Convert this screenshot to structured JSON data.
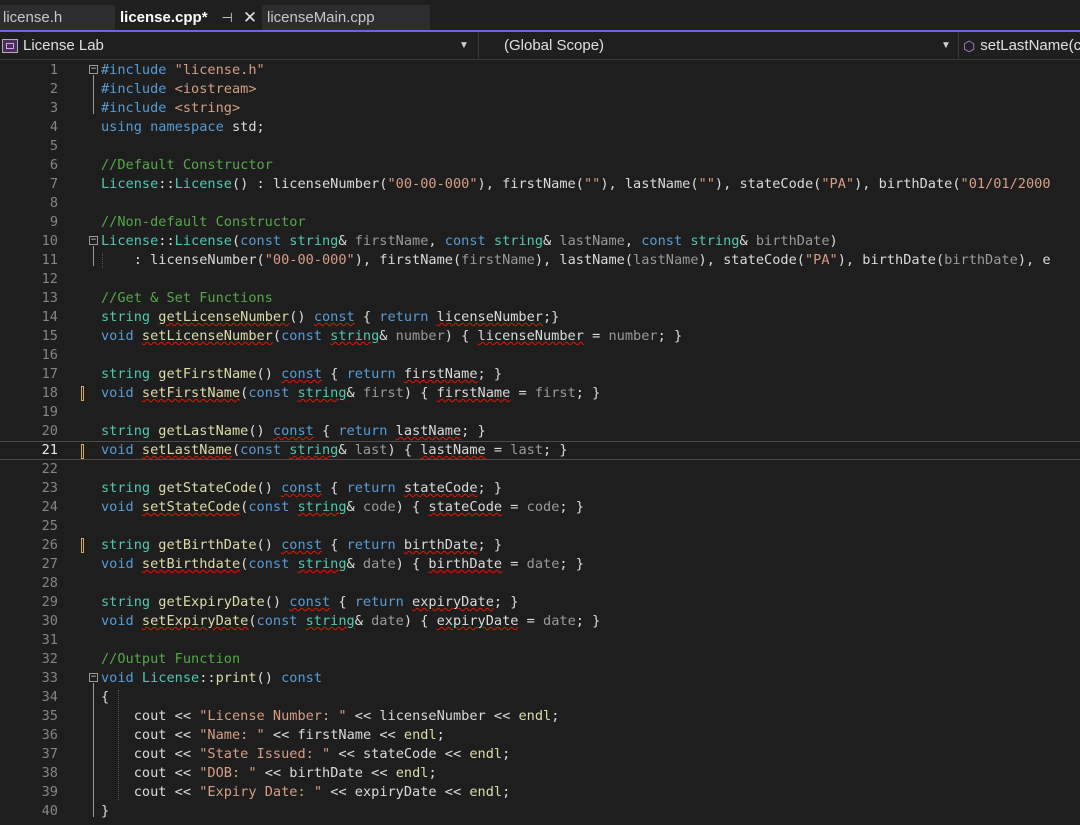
{
  "tabs": [
    {
      "label": "license.h"
    },
    {
      "label": "license.cpp*",
      "pin": "⊣",
      "close": "✕"
    },
    {
      "label": "licenseMain.cpp"
    }
  ],
  "navbar": {
    "project": "License Lab",
    "scope": "(Global Scope)",
    "member": "setLastName(c"
  },
  "editor": {
    "current_line": 21,
    "line_numbers": [
      "1",
      "2",
      "3",
      "4",
      "5",
      "6",
      "7",
      "8",
      "9",
      "10",
      "11",
      "12",
      "13",
      "14",
      "15",
      "16",
      "17",
      "18",
      "19",
      "20",
      "21",
      "22",
      "23",
      "24",
      "25",
      "26",
      "27",
      "28",
      "29",
      "30",
      "31",
      "32",
      "33",
      "34",
      "35",
      "36",
      "37",
      "38",
      "39",
      "40"
    ],
    "lines": [
      [
        [
          "kw",
          "#include "
        ],
        [
          "str",
          "\"license.h\""
        ]
      ],
      [
        [
          "kw",
          "#include "
        ],
        [
          "str",
          "<iostream>"
        ]
      ],
      [
        [
          "kw",
          "#include "
        ],
        [
          "str",
          "<string>"
        ]
      ],
      [
        [
          "kw",
          "using namespace "
        ],
        [
          "",
          "std;"
        ]
      ],
      [],
      [
        [
          "com",
          "//Default Constructor"
        ]
      ],
      [
        [
          "cls",
          "License"
        ],
        [
          "",
          "::"
        ],
        [
          "cls",
          "License"
        ],
        [
          "",
          "() : "
        ],
        [
          "var",
          "licenseNumber"
        ],
        [
          "",
          "("
        ],
        [
          "str",
          "\"00-00-000\""
        ],
        [
          "",
          "), "
        ],
        [
          "var",
          "firstName"
        ],
        [
          "",
          "("
        ],
        [
          "str",
          "\"\""
        ],
        [
          "",
          "), "
        ],
        [
          "var",
          "lastName"
        ],
        [
          "",
          "("
        ],
        [
          "str",
          "\"\""
        ],
        [
          "",
          "), "
        ],
        [
          "var",
          "stateCode"
        ],
        [
          "",
          "("
        ],
        [
          "str",
          "\"PA\""
        ],
        [
          "",
          "), "
        ],
        [
          "var",
          "birthDate"
        ],
        [
          "",
          "("
        ],
        [
          "str",
          "\"01/01/2000"
        ]
      ],
      [],
      [
        [
          "com",
          "//Non-default Constructor"
        ]
      ],
      [
        [
          "cls",
          "License"
        ],
        [
          "",
          "::"
        ],
        [
          "cls",
          "License"
        ],
        [
          "",
          "("
        ],
        [
          "kw",
          "const "
        ],
        [
          "cls",
          "string"
        ],
        [
          "",
          "& "
        ],
        [
          "par",
          "firstName"
        ],
        [
          "",
          ", "
        ],
        [
          "kw",
          "const "
        ],
        [
          "cls",
          "string"
        ],
        [
          "",
          "& "
        ],
        [
          "par",
          "lastName"
        ],
        [
          "",
          ", "
        ],
        [
          "kw",
          "const "
        ],
        [
          "cls",
          "string"
        ],
        [
          "",
          "& "
        ],
        [
          "par",
          "birthDate"
        ],
        [
          "",
          ")"
        ]
      ],
      [
        [
          "",
          "    : "
        ],
        [
          "var",
          "licenseNumber"
        ],
        [
          "",
          "("
        ],
        [
          "str",
          "\"00-00-000\""
        ],
        [
          "",
          "), "
        ],
        [
          "var",
          "firstName"
        ],
        [
          "",
          "("
        ],
        [
          "par",
          "firstName"
        ],
        [
          "",
          "), "
        ],
        [
          "var",
          "lastName"
        ],
        [
          "",
          "("
        ],
        [
          "par",
          "lastName"
        ],
        [
          "",
          "), "
        ],
        [
          "var",
          "stateCode"
        ],
        [
          "",
          "("
        ],
        [
          "str",
          "\"PA\""
        ],
        [
          "",
          "), "
        ],
        [
          "var",
          "birthDate"
        ],
        [
          "",
          "("
        ],
        [
          "par",
          "birthDate"
        ],
        [
          "",
          "), e"
        ]
      ],
      [],
      [
        [
          "com",
          "//Get & Set Functions"
        ]
      ],
      [
        [
          "cls",
          "string "
        ],
        [
          "fn sq",
          "getLicenseNumber"
        ],
        [
          "",
          "() "
        ],
        [
          "kw sq",
          "const"
        ],
        [
          "",
          " { "
        ],
        [
          "kw",
          "return "
        ],
        [
          "var sq",
          "licenseNumber"
        ],
        [
          "",
          ";}"
        ]
      ],
      [
        [
          "kw",
          "void "
        ],
        [
          "fn sq",
          "setLicenseNumber"
        ],
        [
          "",
          "("
        ],
        [
          "kw",
          "const "
        ],
        [
          "cls sq",
          "string"
        ],
        [
          "",
          "& "
        ],
        [
          "par",
          "number"
        ],
        [
          "",
          ") { "
        ],
        [
          "var sq",
          "licenseNumber"
        ],
        [
          "",
          " = "
        ],
        [
          "par",
          "number"
        ],
        [
          "",
          "; }"
        ]
      ],
      [],
      [
        [
          "cls",
          "string "
        ],
        [
          "fn",
          "getFirstName"
        ],
        [
          "",
          "() "
        ],
        [
          "kw sq",
          "const"
        ],
        [
          "",
          " { "
        ],
        [
          "kw",
          "return "
        ],
        [
          "var sq",
          "firstName"
        ],
        [
          "",
          "; }"
        ]
      ],
      [
        [
          "kw",
          "void "
        ],
        [
          "fn sq",
          "setFirstName"
        ],
        [
          "",
          "("
        ],
        [
          "kw",
          "const "
        ],
        [
          "cls sq",
          "string"
        ],
        [
          "",
          "& "
        ],
        [
          "par",
          "first"
        ],
        [
          "",
          ") { "
        ],
        [
          "var sq",
          "firstName"
        ],
        [
          "",
          " = "
        ],
        [
          "par",
          "first"
        ],
        [
          "",
          "; }"
        ]
      ],
      [],
      [
        [
          "cls",
          "string "
        ],
        [
          "fn",
          "getLastName"
        ],
        [
          "",
          "() "
        ],
        [
          "kw sq",
          "const"
        ],
        [
          "",
          " { "
        ],
        [
          "kw",
          "return "
        ],
        [
          "var sq",
          "lastName"
        ],
        [
          "",
          "; }"
        ]
      ],
      [
        [
          "kw",
          "void "
        ],
        [
          "fn sq",
          "setLastName"
        ],
        [
          "",
          "("
        ],
        [
          "kw",
          "const "
        ],
        [
          "cls sq",
          "string"
        ],
        [
          "",
          "& "
        ],
        [
          "par",
          "last"
        ],
        [
          "",
          ") { "
        ],
        [
          "var sq",
          "lastName"
        ],
        [
          "",
          " = "
        ],
        [
          "par",
          "last"
        ],
        [
          "",
          "; }"
        ]
      ],
      [],
      [
        [
          "cls",
          "string "
        ],
        [
          "fn",
          "getStateCode"
        ],
        [
          "",
          "() "
        ],
        [
          "kw sq",
          "const"
        ],
        [
          "",
          " { "
        ],
        [
          "kw",
          "return "
        ],
        [
          "var sq",
          "stateCode"
        ],
        [
          "",
          "; }"
        ]
      ],
      [
        [
          "kw",
          "void "
        ],
        [
          "fn sq",
          "setStateCode"
        ],
        [
          "",
          "("
        ],
        [
          "kw",
          "const "
        ],
        [
          "cls sq",
          "string"
        ],
        [
          "",
          "& "
        ],
        [
          "par",
          "code"
        ],
        [
          "",
          ") { "
        ],
        [
          "var sq",
          "stateCode"
        ],
        [
          "",
          " = "
        ],
        [
          "par",
          "code"
        ],
        [
          "",
          "; }"
        ]
      ],
      [],
      [
        [
          "cls",
          "string "
        ],
        [
          "fn",
          "getBirthDate"
        ],
        [
          "",
          "() "
        ],
        [
          "kw sq",
          "const"
        ],
        [
          "",
          " { "
        ],
        [
          "kw",
          "return "
        ],
        [
          "var sq",
          "birthDate"
        ],
        [
          "",
          "; }"
        ]
      ],
      [
        [
          "kw",
          "void "
        ],
        [
          "fn sq",
          "setBirthdate"
        ],
        [
          "",
          "("
        ],
        [
          "kw",
          "const "
        ],
        [
          "cls sq",
          "string"
        ],
        [
          "",
          "& "
        ],
        [
          "par",
          "date"
        ],
        [
          "",
          ") { "
        ],
        [
          "var sq",
          "birthDate"
        ],
        [
          "",
          " = "
        ],
        [
          "par",
          "date"
        ],
        [
          "",
          "; }"
        ]
      ],
      [],
      [
        [
          "cls",
          "string "
        ],
        [
          "fn",
          "getExpiryDate"
        ],
        [
          "",
          "() "
        ],
        [
          "kw sq",
          "const"
        ],
        [
          "",
          " { "
        ],
        [
          "kw",
          "return "
        ],
        [
          "var sq",
          "expiryDate"
        ],
        [
          "",
          "; }"
        ]
      ],
      [
        [
          "kw",
          "void "
        ],
        [
          "fn sq",
          "setExpiryDate"
        ],
        [
          "",
          "("
        ],
        [
          "kw",
          "const "
        ],
        [
          "cls sq",
          "string"
        ],
        [
          "",
          "& "
        ],
        [
          "par",
          "date"
        ],
        [
          "",
          ") { "
        ],
        [
          "var sq",
          "expiryDate"
        ],
        [
          "",
          " = "
        ],
        [
          "par",
          "date"
        ],
        [
          "",
          "; }"
        ]
      ],
      [],
      [
        [
          "com",
          "//Output Function"
        ]
      ],
      [
        [
          "kw",
          "void "
        ],
        [
          "cls",
          "License"
        ],
        [
          "",
          "::"
        ],
        [
          "fn",
          "print"
        ],
        [
          "",
          "() "
        ],
        [
          "kw",
          "const"
        ]
      ],
      [
        [
          "",
          "{"
        ]
      ],
      [
        [
          "",
          "    "
        ],
        [
          "var",
          "cout"
        ],
        [
          "",
          " << "
        ],
        [
          "str",
          "\"License Number: \""
        ],
        [
          "",
          " << "
        ],
        [
          "var",
          "licenseNumber"
        ],
        [
          "",
          " << "
        ],
        [
          "fn",
          "endl"
        ],
        [
          "",
          ";"
        ]
      ],
      [
        [
          "",
          "    "
        ],
        [
          "var",
          "cout"
        ],
        [
          "",
          " << "
        ],
        [
          "str",
          "\"Name: \""
        ],
        [
          "",
          " << "
        ],
        [
          "var",
          "firstName"
        ],
        [
          "",
          " << "
        ],
        [
          "fn",
          "endl"
        ],
        [
          "",
          ";"
        ]
      ],
      [
        [
          "",
          "    "
        ],
        [
          "var",
          "cout"
        ],
        [
          "",
          " << "
        ],
        [
          "str",
          "\"State Issued: \""
        ],
        [
          "",
          " << "
        ],
        [
          "var",
          "stateCode"
        ],
        [
          "",
          " << "
        ],
        [
          "fn",
          "endl"
        ],
        [
          "",
          ";"
        ]
      ],
      [
        [
          "",
          "    "
        ],
        [
          "var",
          "cout"
        ],
        [
          "",
          " << "
        ],
        [
          "str",
          "\"DOB: \""
        ],
        [
          "",
          " << "
        ],
        [
          "var",
          "birthDate"
        ],
        [
          "",
          " << "
        ],
        [
          "fn",
          "endl"
        ],
        [
          "",
          ";"
        ]
      ],
      [
        [
          "",
          "    "
        ],
        [
          "var",
          "cout"
        ],
        [
          "",
          " << "
        ],
        [
          "str",
          "\"Expiry Date: \""
        ],
        [
          "",
          " << "
        ],
        [
          "var",
          "expiryDate"
        ],
        [
          "",
          " << "
        ],
        [
          "fn",
          "endl"
        ],
        [
          "",
          ";"
        ]
      ],
      [
        [
          "",
          "}"
        ]
      ]
    ]
  }
}
